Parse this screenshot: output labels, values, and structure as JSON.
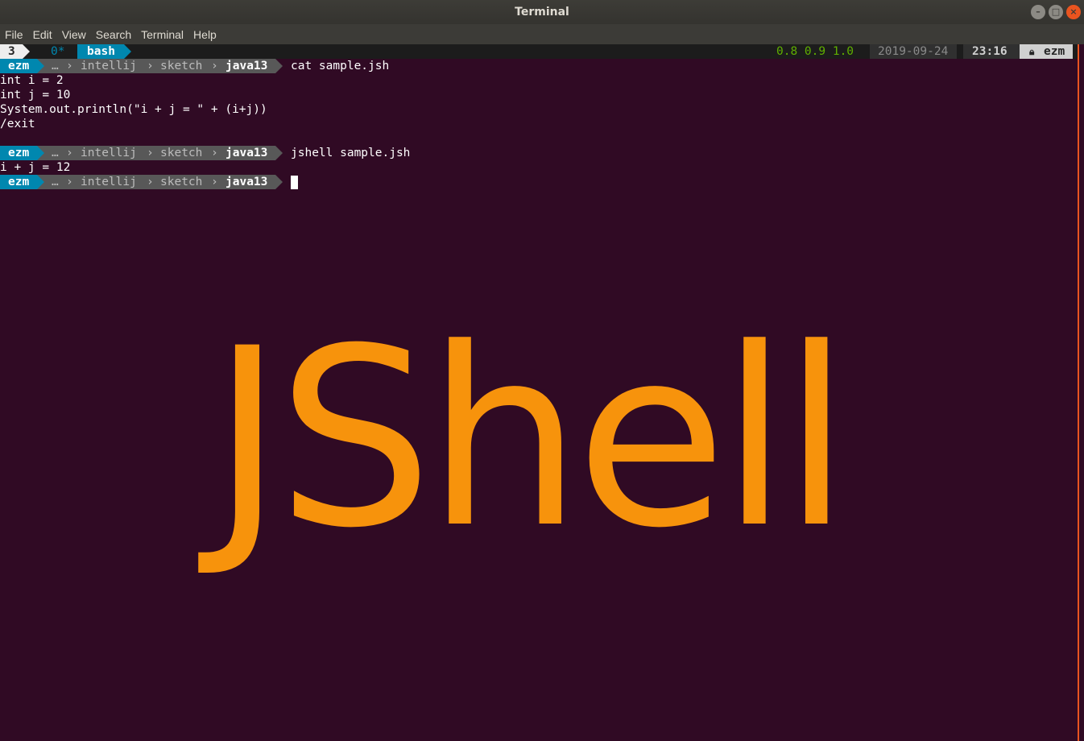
{
  "window": {
    "title": "Terminal"
  },
  "menu": [
    "File",
    "Edit",
    "View",
    "Search",
    "Terminal",
    "Help"
  ],
  "tmux": {
    "session": "3",
    "window_index": "0*",
    "window_name": "bash",
    "load": "0.8 0.9 1.0",
    "date": "2019-09-24",
    "time": "23:16",
    "user": "ezm"
  },
  "prompt": {
    "user": "ezm",
    "ellipsis": "…",
    "dir1": "intellij",
    "dir2": "sketch",
    "dir3": "java13"
  },
  "commands": {
    "cmd1": "cat sample.jsh",
    "cmd2": "jshell sample.jsh"
  },
  "output": [
    "int i = 2",
    "int j = 10",
    "System.out.println(\"i + j = \" + (i+j))",
    "/exit",
    "i + j = 12"
  ],
  "overlay_text": "JShell",
  "colors": {
    "background": "#300a24",
    "accent": "#f7930c",
    "prompt_blue": "#0087af"
  }
}
